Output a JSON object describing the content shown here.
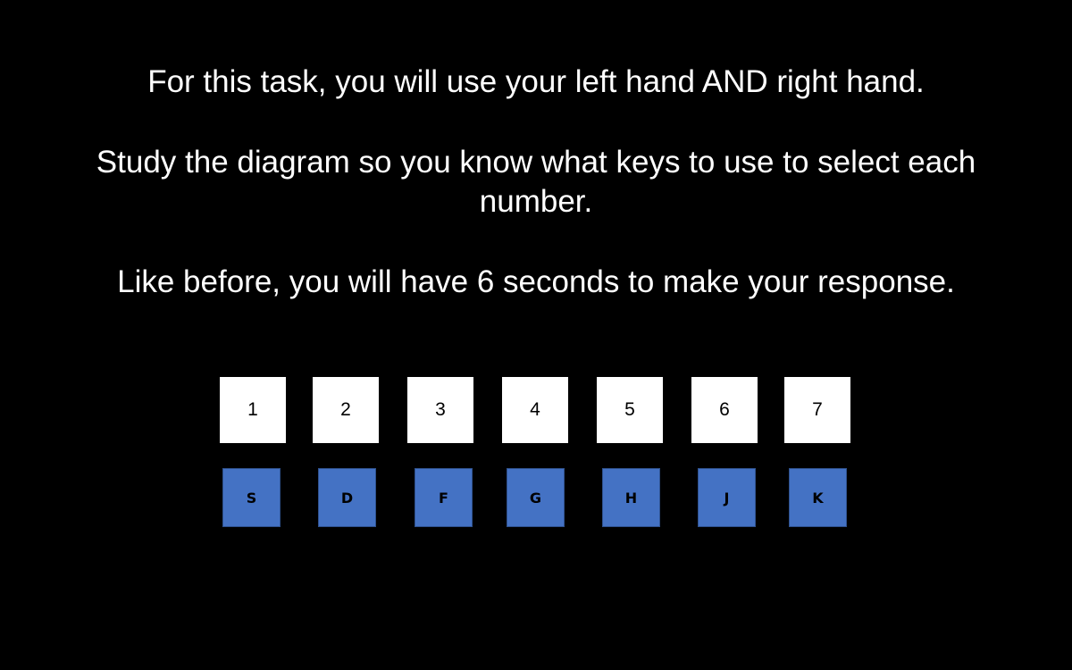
{
  "instructions": {
    "line1": "For this task, you will use your left hand AND right hand.",
    "line2a": "Study the diagram so you know what keys to use to select each",
    "line2b": "number.",
    "line3": "Like before, you will have 6 seconds to make your response."
  },
  "numbers": [
    "1",
    "2",
    "3",
    "4",
    "5",
    "6",
    "7"
  ],
  "keys": [
    "S",
    "D",
    "F",
    "G",
    "H",
    "J",
    "K"
  ],
  "colors": {
    "background": "#000000",
    "text": "#ffffff",
    "number_box": "#ffffff",
    "key_box": "#4472c4",
    "key_border": "#2f528f"
  }
}
